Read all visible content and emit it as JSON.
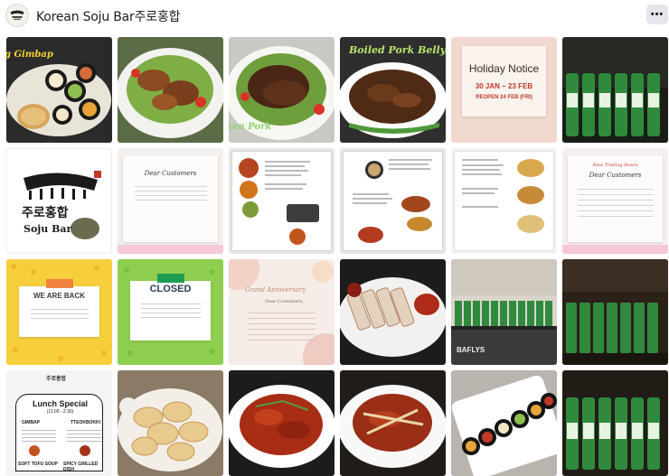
{
  "header": {
    "page_name": "Korean Soju Bar주로홍합",
    "more_label": "•••"
  },
  "tiles": {
    "t1": {
      "overlay": "g Gimbap"
    },
    "t4": {
      "overlay": "Boiled Pork Belly"
    },
    "t5": {
      "title": "Holiday Notice",
      "dates": "30 JAN ~ 23 FEB",
      "reopen": "REOPEN 24 FEB (FRI)"
    },
    "t3": {
      "overlay": "Grilled Chicken Pork"
    },
    "t7": {
      "logo_korean": "주로홍합",
      "logo_english": "Soju Bar"
    },
    "t8": {
      "title": "Dear Customers"
    },
    "t12": {
      "heading": "New Trading Hours",
      "title": "Dear Customers"
    },
    "t13": {
      "label": "WE ARE BACK"
    },
    "t14": {
      "label": "CLOSED"
    },
    "t15": {
      "title": "Grand Anniversary",
      "subtitle": "Dear Customers,"
    },
    "t17": {
      "sign": "BAFLYS"
    },
    "t19": {
      "brand": "주로홍합",
      "title": "Lunch Special",
      "hours": "(11:00 - 2:30)",
      "col1": "GIMBAP",
      "col2": "TTEOKBOKKI",
      "foot1": "SOFT TOFU SOUP",
      "foot2": "SPICY GRILLED DISH"
    }
  },
  "icons": {
    "avatar": "soju-bar-logo-icon",
    "more": "more-options-icon"
  },
  "colors": {
    "header_button_bg": "#e4e6eb",
    "holiday_red": "#c0392b",
    "closed_green": "#1e9e54",
    "back_orange": "#f2833f"
  }
}
